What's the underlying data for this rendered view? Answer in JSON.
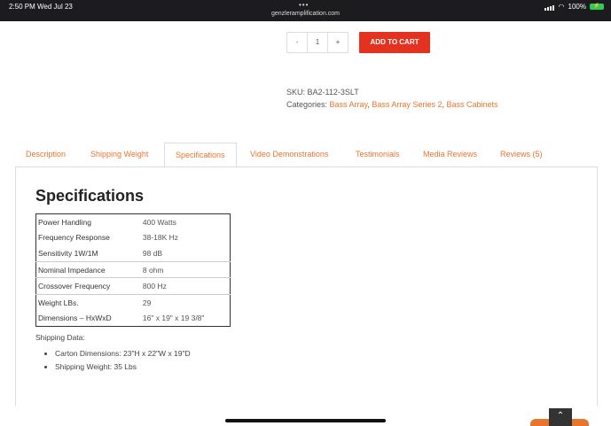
{
  "status_bar": {
    "time": "2:50 PM",
    "date": "Wed Jul 23",
    "url": "genzleramplification.com",
    "battery": "100%"
  },
  "product": {
    "qty_minus": "-",
    "qty_value": "1",
    "qty_plus": "+",
    "add_to_cart": "ADD TO CART",
    "sku_label": "SKU:",
    "sku": "BA2-112-3SLT",
    "categories_label": "Categories:",
    "categories": [
      "Bass Array",
      "Bass Array Series 2",
      "Bass Cabinets"
    ]
  },
  "tabs": [
    {
      "label": "Description"
    },
    {
      "label": "Shipping Weight"
    },
    {
      "label": "Specifications"
    },
    {
      "label": "Video Demonstrations"
    },
    {
      "label": "Testimonials"
    },
    {
      "label": "Media Reviews"
    },
    {
      "label": "Reviews (5)"
    }
  ],
  "specifications": {
    "title": "Specifications",
    "rows": [
      {
        "label": "Power Handling",
        "value": "400 Watts"
      },
      {
        "label": "Frequency Response",
        "value": "38-18K Hz"
      },
      {
        "label": "Sensitivity 1W/1M",
        "value": "98 dB"
      },
      {
        "label": "Nominal Impedance",
        "value": "8 ohm"
      },
      {
        "label": "Crossover Frequency",
        "value": "800 Hz"
      },
      {
        "label": "Weight LBs.",
        "value": "29"
      },
      {
        "label": "Dimensions – HxWxD",
        "value": "16\" x 19\" x 19 3/8\""
      }
    ],
    "shipping_title": "Shipping Data:",
    "shipping": [
      "Carton Dimensions: 23\"H x 22\"W x 19\"D",
      "Shipping Weight: 35 Lbs"
    ]
  },
  "colors": {
    "accent": "#e8752f",
    "cart": "#e3321f"
  },
  "icons": {
    "scroll_top": "chevron-up-icon"
  }
}
